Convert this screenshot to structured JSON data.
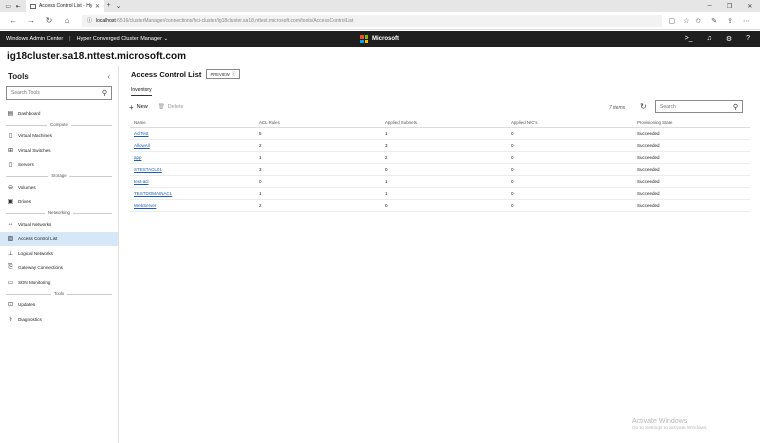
{
  "browser": {
    "tab_title": "Access Control List - Hy",
    "url_host": "localhost",
    "url_path": ":6516/clusterManager/connections/hci-cluster/ig18cluster.sa18.nttest.microsoft.com/tools/AccessControlList",
    "icons": [
      "back-icon",
      "forward-icon",
      "refresh-icon",
      "home-icon",
      "star-icon",
      "favorites-icon",
      "share-icon",
      "more-icon"
    ]
  },
  "app": {
    "product": "Windows Admin Center",
    "context": "Hyper Converged Cluster Manager",
    "brand": "Microsoft",
    "cluster_name": "ig18cluster.sa18.nttest.microsoft.com",
    "header_icons": [
      "terminal-icon",
      "bell-icon",
      "gear-icon",
      "help-icon"
    ]
  },
  "sidebar": {
    "title": "Tools",
    "search_placeholder": "Search Tools",
    "groups": {
      "compute": "Compute",
      "storage": "Storage",
      "networking": "Networking",
      "tools": "Tools"
    },
    "items": {
      "dashboard": "Dashboard",
      "virtual_machines": "Virtual Machines",
      "virtual_switches": "Virtual Switches",
      "servers": "Servers",
      "volumes": "Volumes",
      "drives": "Drives",
      "virtual_networks": "Virtual Networks",
      "access_control_list": "Access Control List",
      "logical_networks": "Logical Networks",
      "gateway_connections": "Gateway Connections",
      "sdn_monitoring": "SDN Monitoring",
      "updates": "Updates",
      "diagnostics": "Diagnostics"
    }
  },
  "main": {
    "title": "Access Control List",
    "badge": "PREVIEW",
    "tab": "Inventory",
    "new_label": "New",
    "delete_label": "Delete",
    "items_count": "7 items",
    "search_placeholder": "Search",
    "columns": [
      "Name",
      "ACL Rules",
      "Applied Subnets",
      "Applied NIC's",
      "Provisioning State"
    ],
    "rows": [
      [
        "AclTest",
        "5",
        "1",
        "0",
        "Succeeded"
      ],
      [
        "AllowAll",
        "2",
        "3",
        "0",
        "Succeeded"
      ],
      [
        "app",
        "1",
        "2",
        "0",
        "Succeeded"
      ],
      [
        "STESTACL01",
        "3",
        "0",
        "0",
        "Succeeded"
      ],
      [
        "test-acl",
        "0",
        "1",
        "0",
        "Succeeded"
      ],
      [
        "TESTDOMAINACL",
        "1",
        "1",
        "0",
        "Succeeded"
      ],
      [
        "WebServer",
        "2",
        "0",
        "0",
        "Succeeded"
      ]
    ]
  },
  "watermark": {
    "line1": "Activate Windows",
    "line2": "Go to Settings to activate Windows."
  },
  "colors": {
    "header_bg": "#1f1f1f",
    "active_item": "#d6e7f8",
    "link": "#1a5fb4"
  }
}
